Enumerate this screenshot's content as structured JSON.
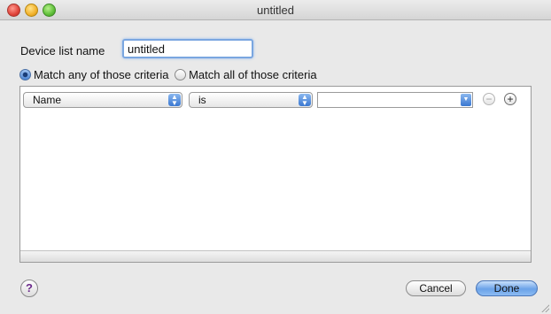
{
  "window": {
    "title": "untitled"
  },
  "form": {
    "name_label": "Device list name",
    "name_value": "untitled",
    "match_any_label": "Match any of those criteria",
    "match_all_label": "Match all of those criteria",
    "match_selected": "any"
  },
  "criteria": [
    {
      "field": "Name",
      "operator": "is",
      "value": ""
    }
  ],
  "buttons": {
    "cancel": "Cancel",
    "done": "Done",
    "help": "?"
  },
  "colors": {
    "accent": "#6aa2e8",
    "window_bg": "#e9e9e9"
  },
  "icons": {
    "remove": "minus-icon",
    "add": "plus-icon",
    "help": "help-icon"
  }
}
